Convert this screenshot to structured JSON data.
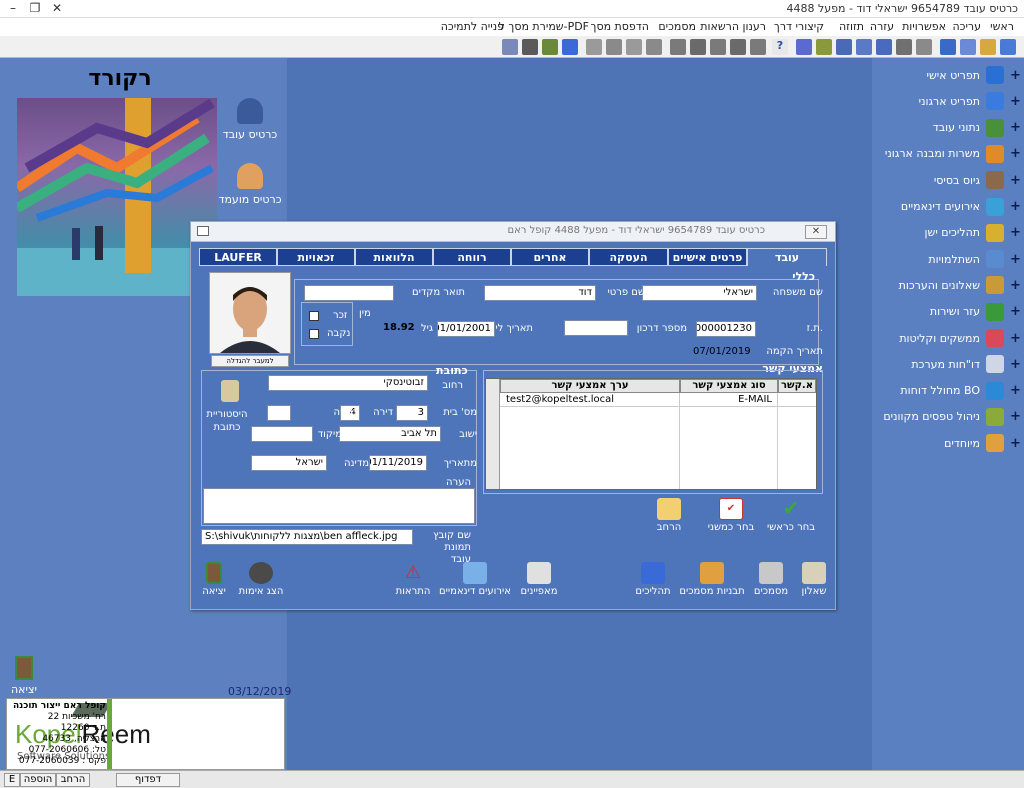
{
  "window": {
    "title": "כרטיס עובד 9654789 ישראלי דוד - מפעל 4488"
  },
  "menu": [
    "ראשי",
    "עריכה",
    "אפשרויות",
    "עזרה",
    "תזוזה",
    "קיצורי דרך",
    "רענון הרשאות",
    "מסמכים",
    "הדפסת מסך",
    "שמירת מסך ל-PDF",
    "פנייה לתמיכה"
  ],
  "sidebar": {
    "items": [
      {
        "label": "תפריט אישי",
        "color": "#2a6fd6"
      },
      {
        "label": "תפריט ארגוני",
        "color": "#3a7be0"
      },
      {
        "label": "נתוני עובד",
        "color": "#4a8f3a"
      },
      {
        "label": "משרות ומבנה ארגוני",
        "color": "#e08a2a"
      },
      {
        "label": "גיוס בסיסי",
        "color": "#8a6a4a"
      },
      {
        "label": "אירועים דינאמיים",
        "color": "#3aa0d8"
      },
      {
        "label": "תהליכים ישן",
        "color": "#d8b030"
      },
      {
        "label": "השתלמויות",
        "color": "#5a8ad0"
      },
      {
        "label": "שאלונים והערכות",
        "color": "#c89a3a"
      },
      {
        "label": "עזר ושירות",
        "color": "#3a9a3a"
      },
      {
        "label": "ממשקים וקליטות",
        "color": "#d84a5a"
      },
      {
        "label": "דו\"חות מערכת",
        "color": "#cfd6e6"
      },
      {
        "label": "מחולל דוחות BO",
        "color": "#2a8ad8"
      },
      {
        "label": "ניהול טפסים מקוונים",
        "color": "#8aaa3a"
      },
      {
        "label": "מיוחדים",
        "color": "#e0a040"
      }
    ]
  },
  "left": {
    "title": "רקורד",
    "employee_card": "כרטיס עובד",
    "candidate_card": "כרטיס מועמד",
    "exit_label": "יציאה",
    "date": "03/12/2019",
    "company": {
      "name": "קופל ראם ייצור תוכנה",
      "street": "רח' משכיות 22",
      "pobox": "ת.ד 12260",
      "city": "הרצליה, 46733",
      "phone": "טל: 077-2060606",
      "fax": "פקס : 077-2060039"
    },
    "logo": {
      "brand1": "Kopel",
      "brand2": "Reem",
      "tagline": "Software Solutions"
    }
  },
  "dialog": {
    "title": "כרטיס עובד 9654789 ישראלי דוד - מפעל 4488 קופל ראם",
    "close": "✕",
    "tabs": [
      "עובד",
      "פרטים אישיים",
      "העסקה",
      "אחרים",
      "רווחה",
      "הלוואות",
      "זכאויות",
      "LAUFER"
    ],
    "general": {
      "heading": "כללי",
      "last_name_label": "שם משפחה",
      "last_name": "ישראלי",
      "first_name_label": "שם פרטי",
      "first_name": "דוד",
      "prev_title_label": "תואר מקדים",
      "prev_title": "",
      "id_label": "ת.ז.",
      "id": "000001230",
      "passport_label": "מספר דרכון",
      "passport": "",
      "birth_label": "תאריך לידה",
      "birth": "01/01/2001",
      "age_label": "גיל",
      "age": "18.92",
      "gender_label": "מין",
      "male": "זכר",
      "female": "נקבה",
      "created_label": "תאריך הקמה",
      "created": "07/01/2019",
      "photo_caption": "למעבר להגדלה"
    },
    "address": {
      "heading": "כתובת",
      "history": "היסטוריית כתובת",
      "street_label": "רחוב",
      "street": "זבוטינסקי",
      "house_label": "מס' בית",
      "house": "3",
      "apt_label": "דירה",
      "apt": "4",
      "entrance_label": "כניסה",
      "entrance": "",
      "city_label": "ישוב",
      "city": "תל אביב",
      "zip_label": "מיקוד",
      "zip": "",
      "from_label": "מתאריך",
      "from": "01/11/2019",
      "country_label": "מדינה",
      "country": "ישראל",
      "note_label": "הערה",
      "note": "",
      "photo_file_label": "שם קובץ תמונת עובד",
      "photo_file": "S:\\shivuk\\מצגות ללקוחות\\ben affleck.jpg"
    },
    "contacts": {
      "heading": "אמצעי קשר",
      "columns": [
        "א.קשר",
        "סוג אמצעי קשר",
        "ערך אמצעי קשר"
      ],
      "rows": [
        {
          "id": "",
          "type": "E-MAIL",
          "value": "test2@kopeltest.local"
        }
      ],
      "btn_main": "בחר כראשי",
      "btn_secondary": "בחר כמשני",
      "btn_expand": "הרחב"
    },
    "bottom_buttons": [
      "שאלון",
      "מסמכים",
      "תבניות מסמכים",
      "תהליכים",
      "מאפיינים",
      "אירועים דינאמיים",
      "התראות",
      "הצג אימות",
      "יציאה"
    ]
  },
  "status": {
    "page": "דפדוף",
    "expand": "הרחב",
    "add": "הוספה",
    "e": "E"
  }
}
